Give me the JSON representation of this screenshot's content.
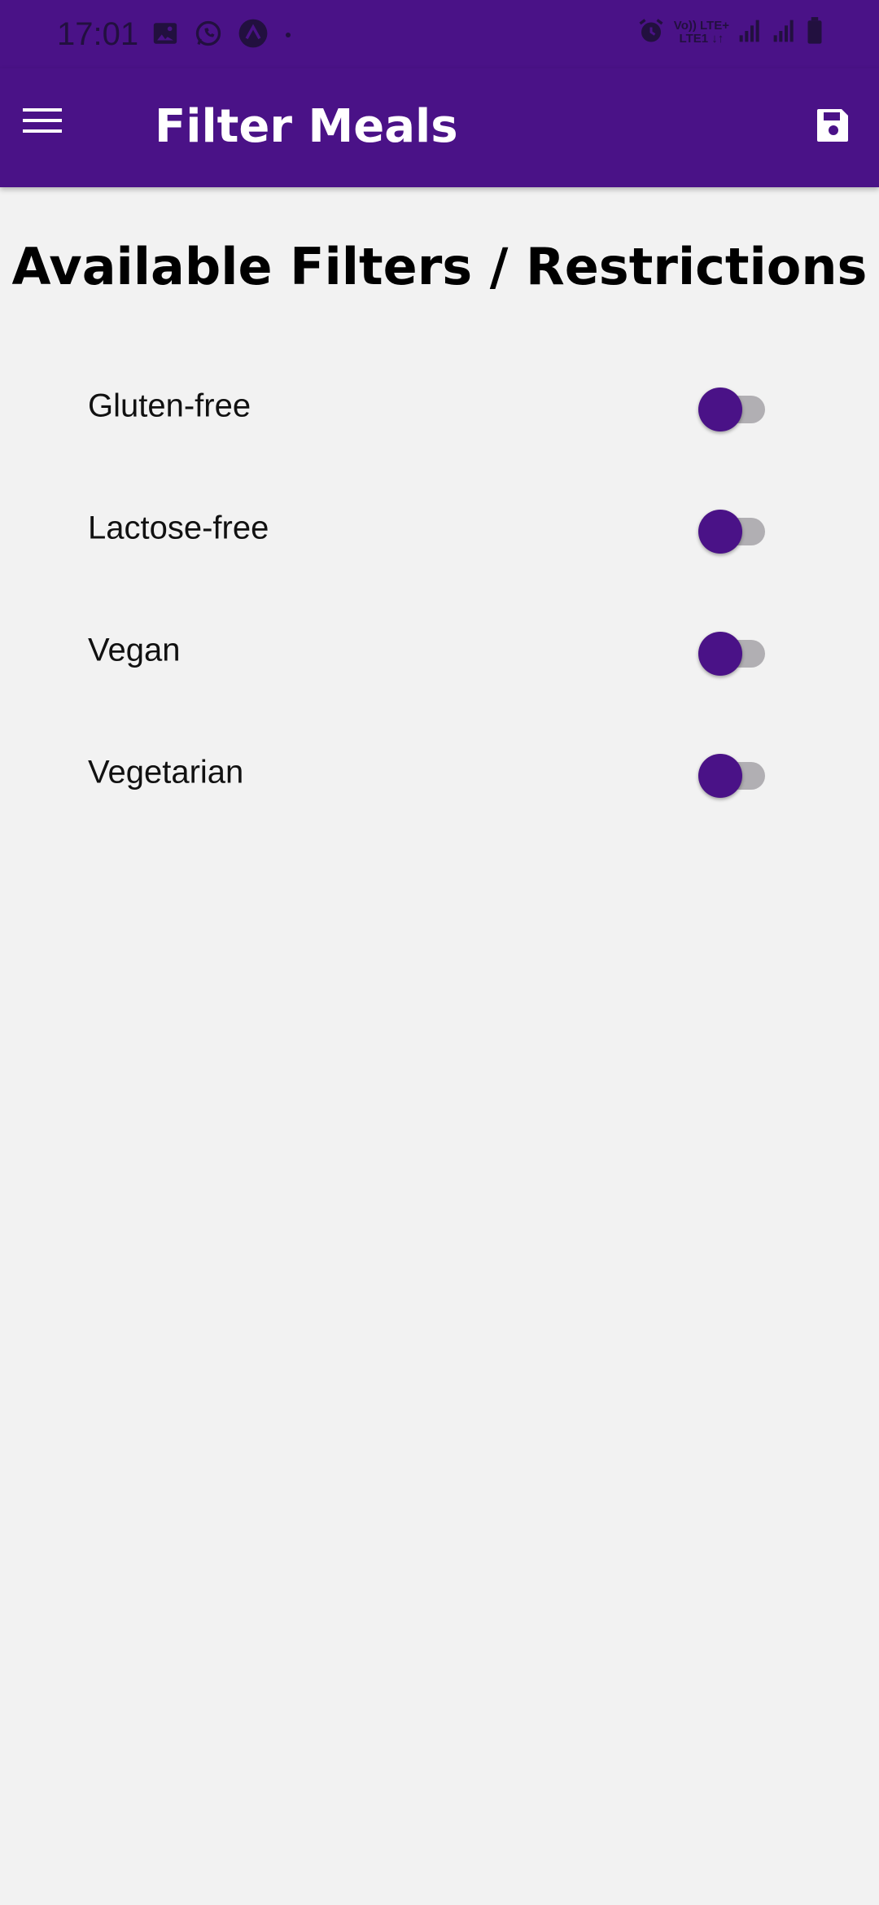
{
  "status_bar": {
    "time": "17:01",
    "left_icons": [
      "gallery-icon",
      "whatsapp-icon",
      "expo-icon",
      "notification-dot-icon"
    ],
    "network_line1": "Vo)) LTE+",
    "network_line2": "LTE1 ↓↑",
    "right_icons": [
      "alarm-icon",
      "signal-icon",
      "signal-icon",
      "battery-icon"
    ]
  },
  "app_bar": {
    "title": "Filter Meals",
    "menu_icon": "hamburger-menu-icon",
    "save_icon": "save-icon",
    "background": "#4a1287"
  },
  "page": {
    "heading": "Available Filters / Restrictions"
  },
  "filters": [
    {
      "label": "Gluten-free",
      "enabled": false
    },
    {
      "label": "Lactose-free",
      "enabled": false
    },
    {
      "label": "Vegan",
      "enabled": false
    },
    {
      "label": "Vegetarian",
      "enabled": false
    }
  ],
  "colors": {
    "accent": "#4a1287",
    "background": "#f2f2f2",
    "track_off": "#b1afb3"
  }
}
